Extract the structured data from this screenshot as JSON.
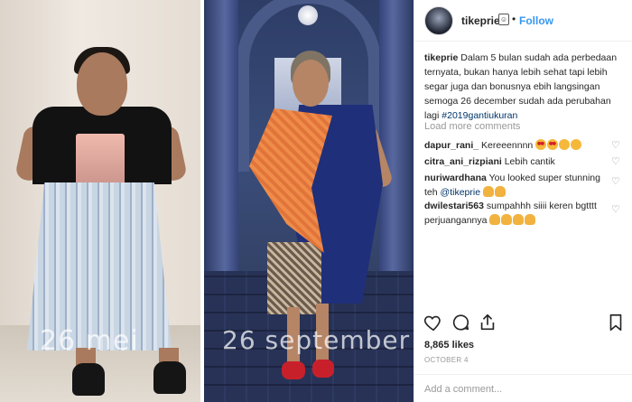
{
  "post": {
    "username": "tikeprie",
    "follow_label": "Follow",
    "separator": "•",
    "caption": "Dalam 5 bulan sudah ada perbedaan ternyata, bukan hanya lebih sehat tapi lebih segar juga dan bonusnya ebih langsingan semoga 26 december sudah ada perubahan lagi",
    "hashtag": "#2019gantiukuran",
    "load_more": "Load more comments",
    "likes": "8,865 likes",
    "date": "OCTOBER 4",
    "add_comment_placeholder": "Add a comment..."
  },
  "media": {
    "left_date": "26 mei",
    "right_date": "26 september"
  },
  "comments": [
    {
      "user": "dapur_rani_",
      "text": "Kereeennnn",
      "emojis": [
        "heart-eyes",
        "heart-eyes",
        "smile",
        "smile"
      ]
    },
    {
      "user": "citra_ani_rizpiani",
      "text": "Lebih cantik",
      "emojis": []
    },
    {
      "user": "nuriwardhana",
      "text": "You looked super stunning teh",
      "mention": "@tikeprie",
      "emojis": [
        "hand",
        "hand"
      ]
    },
    {
      "user": "dwilestari563",
      "text": "sumpahhh siiii keren bgtttt perjuangannya",
      "emojis": [
        "hand",
        "hand",
        "hand",
        "hand"
      ]
    }
  ],
  "icons": {
    "like": "heart-icon",
    "comment": "comment-bubble-icon",
    "share": "share-icon",
    "save": "bookmark-icon",
    "comment_like": "small-heart-icon"
  },
  "colors": {
    "link_blue": "#3897f0",
    "hashtag": "#003569",
    "muted": "#999999"
  }
}
